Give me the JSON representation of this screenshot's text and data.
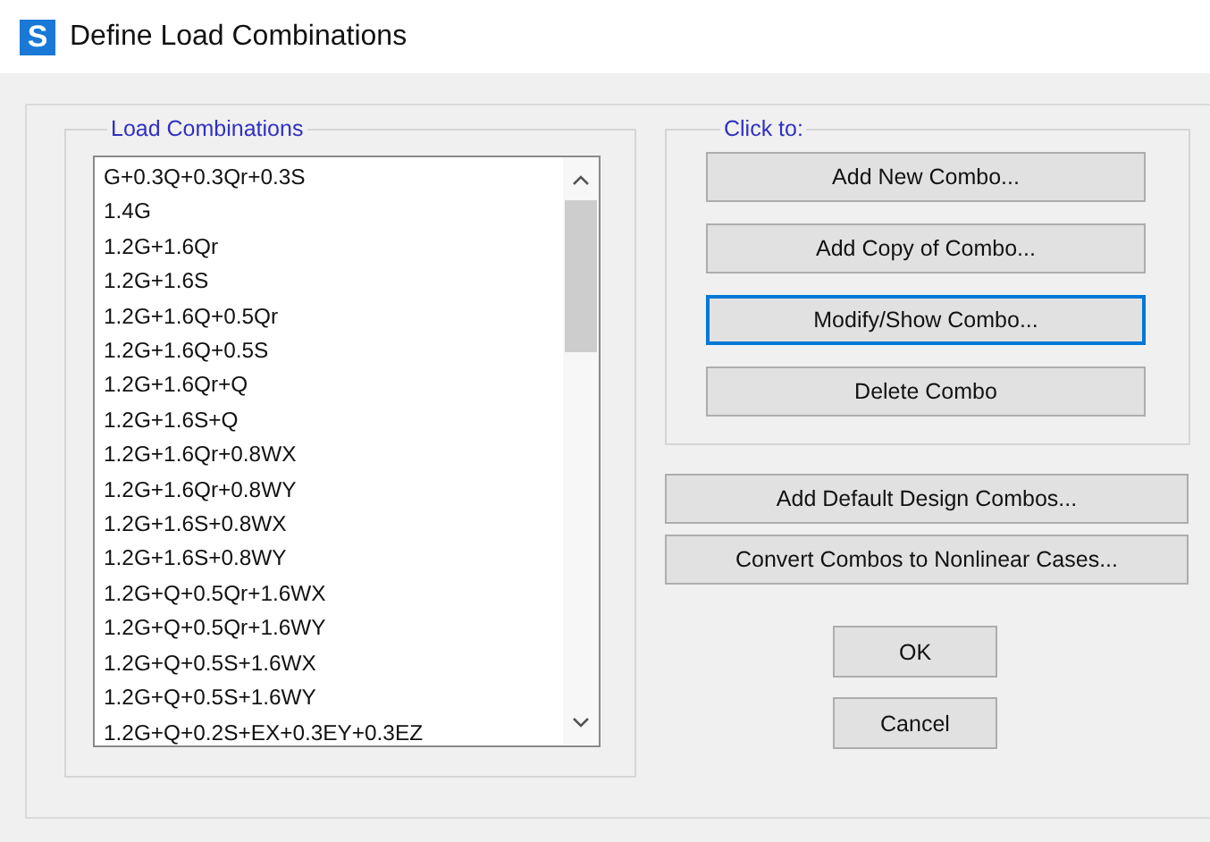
{
  "window": {
    "icon_letter": "S",
    "title": "Define Load Combinations"
  },
  "combinations": {
    "label": "Load Combinations",
    "items": [
      "G+0.3Q+0.3Qr+0.3S",
      "1.4G",
      "1.2G+1.6Qr",
      "1.2G+1.6S",
      "1.2G+1.6Q+0.5Qr",
      "1.2G+1.6Q+0.5S",
      "1.2G+1.6Qr+Q",
      "1.2G+1.6S+Q",
      "1.2G+1.6Qr+0.8WX",
      "1.2G+1.6Qr+0.8WY",
      "1.2G+1.6S+0.8WX",
      "1.2G+1.6S+0.8WY",
      "1.2G+Q+0.5Qr+1.6WX",
      "1.2G+Q+0.5Qr+1.6WY",
      "1.2G+Q+0.5S+1.6WX",
      "1.2G+Q+0.5S+1.6WY",
      "1.2G+Q+0.2S+EX+0.3EY+0.3EZ"
    ]
  },
  "click_to": {
    "label": "Click to:",
    "buttons": [
      {
        "label": "Add New Combo...",
        "focused": false
      },
      {
        "label": "Add Copy of Combo...",
        "focused": false
      },
      {
        "label": "Modify/Show Combo...",
        "focused": true
      },
      {
        "label": "Delete Combo",
        "focused": false
      }
    ]
  },
  "extra_buttons": [
    "Add Default Design Combos...",
    "Convert Combos to Nonlinear Cases..."
  ],
  "dialog_buttons": [
    "OK",
    "Cancel"
  ]
}
